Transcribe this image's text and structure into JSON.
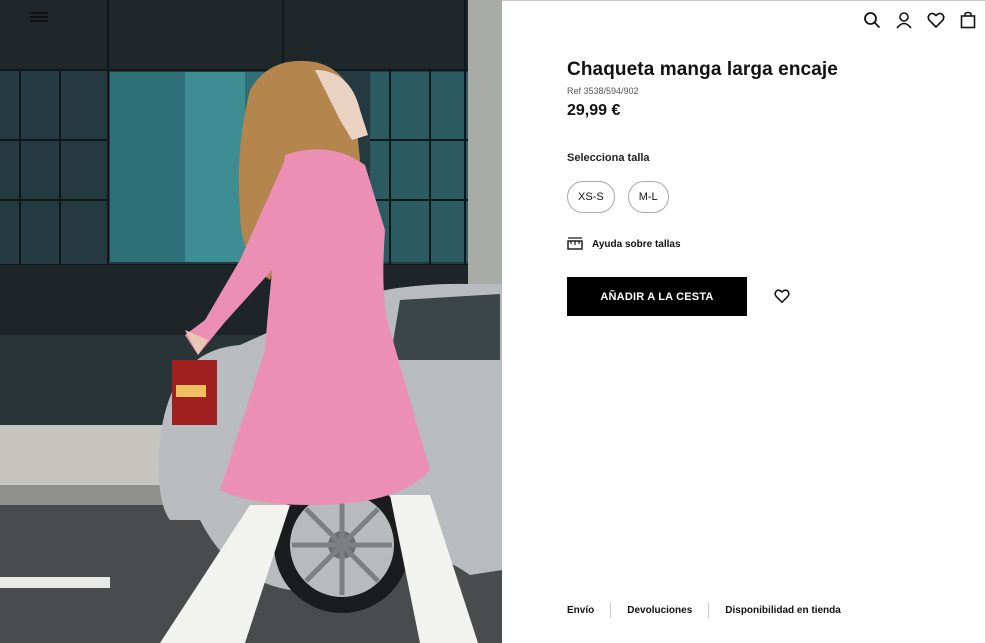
{
  "header": {
    "menu_icon": "hamburger-menu-icon",
    "icons": [
      "search-icon",
      "user-icon",
      "heart-icon",
      "bag-icon"
    ]
  },
  "product": {
    "image_icon": "product-photo",
    "title": "Chaqueta manga larga encaje",
    "ref": "Ref 3538/594/902",
    "price": "29,99 €",
    "size_label": "Selecciona talla",
    "sizes": [
      "XS-S",
      "M-L"
    ],
    "size_help": "Ayuda sobre tallas",
    "add_to_cart": "AÑADIR A LA CESTA"
  },
  "footer": {
    "links": [
      "Envío",
      "Devoluciones",
      "Disponibilidad en tienda"
    ]
  }
}
